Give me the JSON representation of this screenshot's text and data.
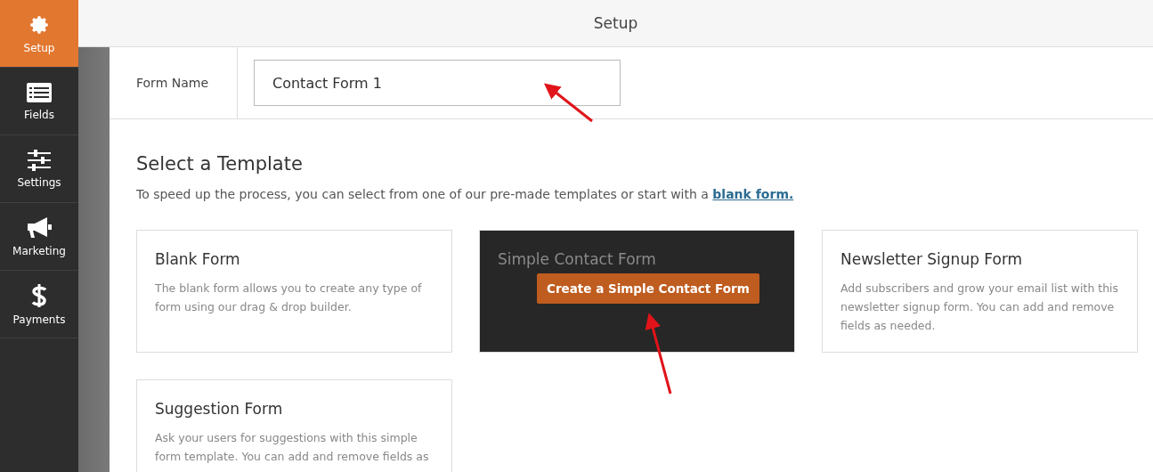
{
  "sidebar": {
    "items": [
      {
        "label": "Setup",
        "selected": true
      },
      {
        "label": "Fields",
        "selected": false
      },
      {
        "label": "Settings",
        "selected": false
      },
      {
        "label": "Marketing",
        "selected": false
      },
      {
        "label": "Payments",
        "selected": false
      }
    ]
  },
  "header": {
    "title": "Setup"
  },
  "form_name": {
    "label": "Form Name",
    "value": "Contact Form 1"
  },
  "templates": {
    "heading": "Select a Template",
    "intro": "To speed up the process, you can select from one of our pre-made templates or start with a ",
    "intro_link": "blank form.",
    "cards": [
      {
        "title": "Blank Form",
        "description": "The blank form allows you to create any type of form using our drag & drop builder.",
        "hovered": false
      },
      {
        "title": "Simple Contact Form",
        "hovered": true,
        "button": "Create a Simple Contact Form"
      },
      {
        "title": "Newsletter Signup Form",
        "description": "Add subscribers and grow your email list with this newsletter signup form. You can add and remove fields as needed.",
        "hovered": false
      },
      {
        "title": "Suggestion Form",
        "description": "Ask your users for suggestions with this simple form template. You can add and remove fields as",
        "hovered": false
      }
    ]
  }
}
